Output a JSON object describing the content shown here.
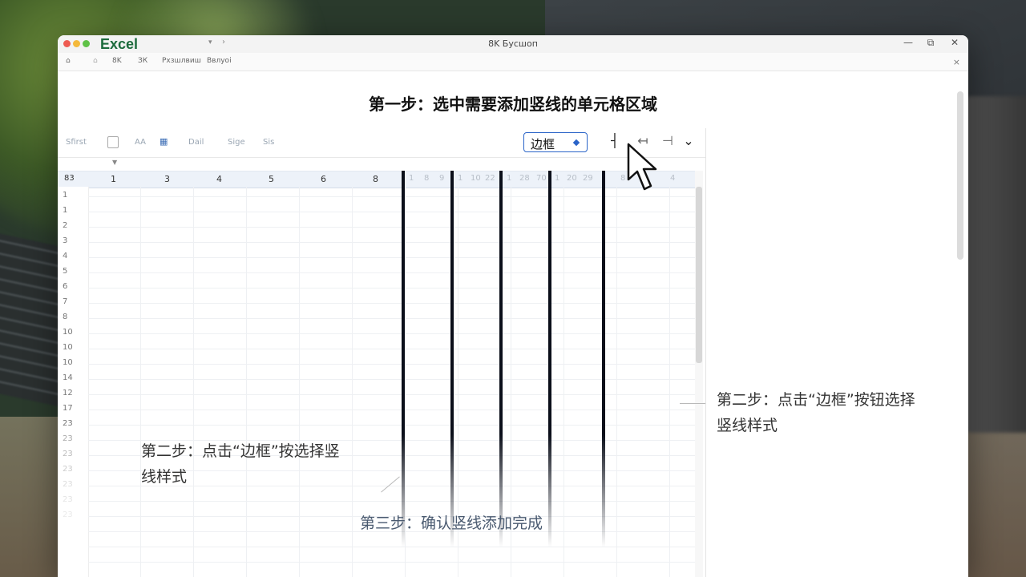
{
  "window": {
    "app_name": "Excel",
    "title": "8K Бусшоп",
    "controls": {
      "minimize": "—",
      "maximize": "⧉",
      "close": "✕"
    }
  },
  "toolbar2": {
    "items": [
      "⌂",
      "⌂",
      "8K",
      "ЗК",
      "Рхзшлвиш",
      "Ввлуоі"
    ],
    "close": "×"
  },
  "heading": "第一步：选中需要添加竖线的单元格区域",
  "ribbon": {
    "items": [
      "Sfirst",
      "AA",
      "Dail",
      "Sige",
      "Sis"
    ],
    "border_button_label": "边框",
    "border_icons": [
      "┤",
      "↤",
      "⊣",
      "⌄"
    ]
  },
  "columns": {
    "corner": "83",
    "main": [
      "1",
      "3",
      "4",
      "5",
      "6",
      "8"
    ],
    "faint": [
      "1",
      "8",
      "9",
      "1",
      "10",
      "22",
      "1",
      "28",
      "70",
      "1",
      "20",
      "29",
      "8",
      "4"
    ]
  },
  "rows": [
    "1",
    "1",
    "2",
    "3",
    "4",
    "5",
    "6",
    "7",
    "8",
    "10",
    "10",
    "10",
    "14",
    "12",
    "17",
    "23",
    "23",
    "23",
    "23",
    "23",
    "23",
    "23"
  ],
  "notes": {
    "left": "第二步：点击“边框”按选择竖线样式",
    "right": "第二步：点击“边框”按钮选择竖线样式",
    "bottom": "第三步：确认竖线添加完成"
  },
  "colors": {
    "accent": "#2a64c8",
    "excel_green": "#1d6b3d",
    "vertical_line": "#0b0f1a"
  }
}
